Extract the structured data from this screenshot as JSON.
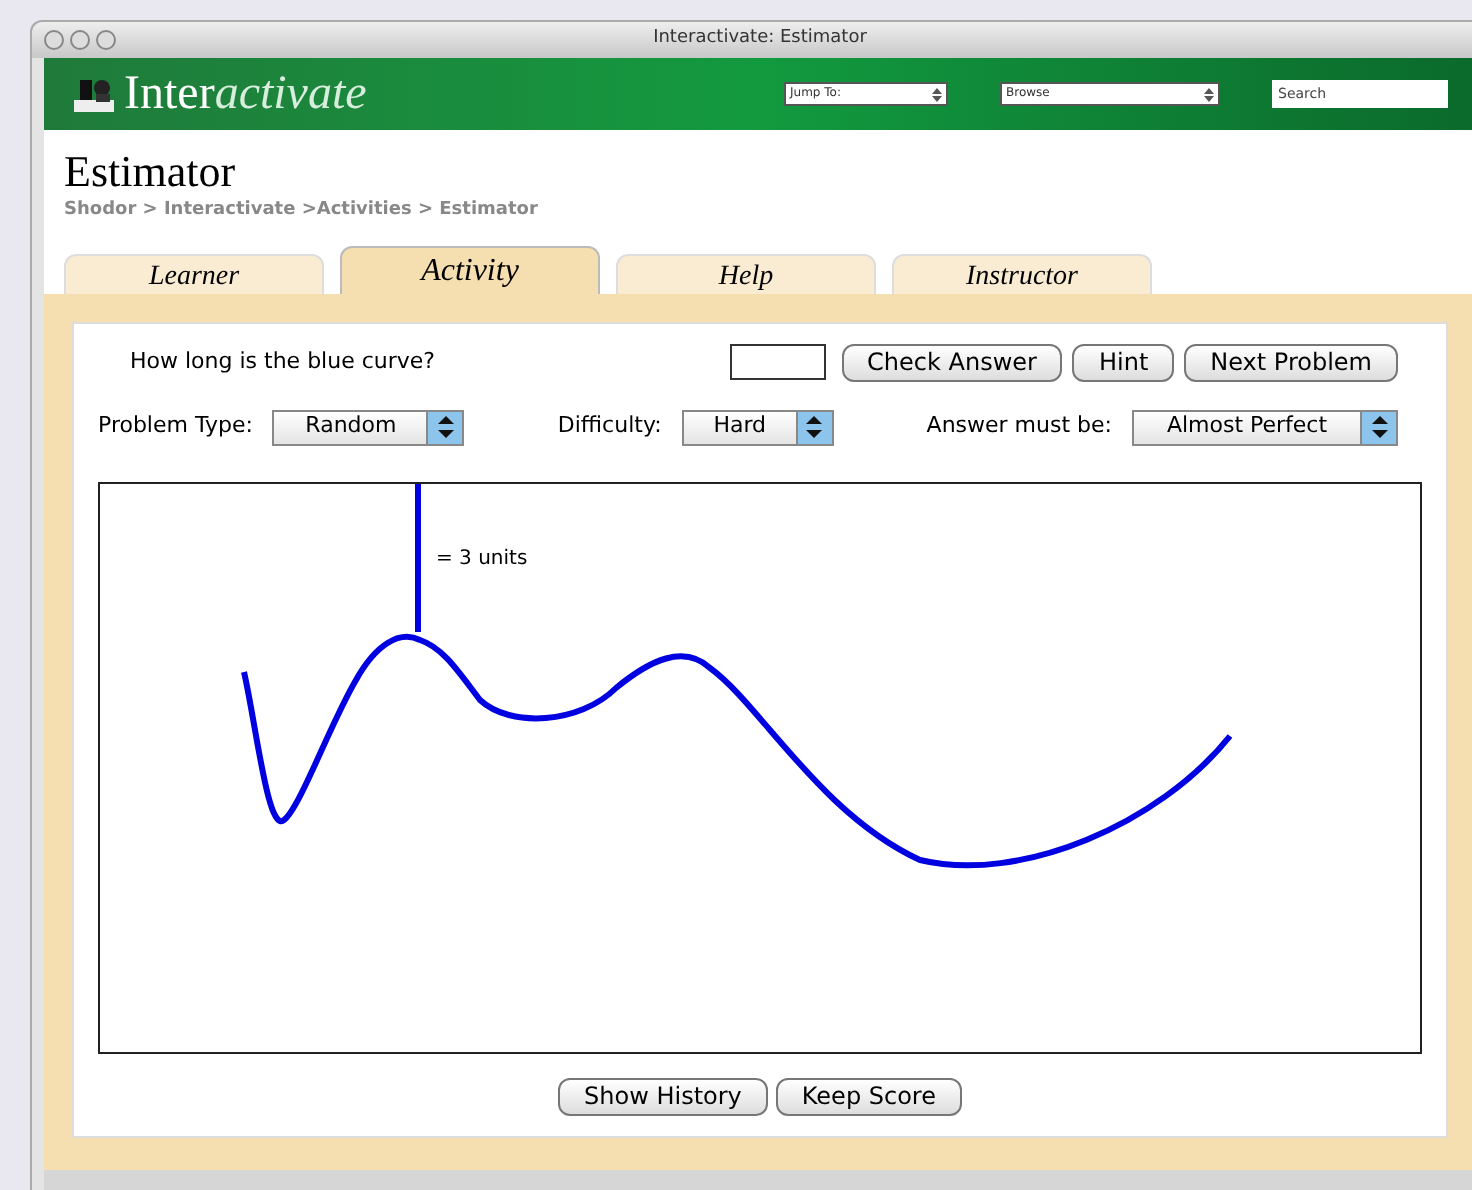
{
  "window": {
    "title": "Interactivate: Estimator"
  },
  "header": {
    "logo_plain": "Inter",
    "logo_italic": "activate",
    "fields": [
      {
        "kind": "select",
        "label": "Jump To:"
      },
      {
        "kind": "select",
        "label": "Browse"
      },
      {
        "kind": "search",
        "placeholder": "Search"
      }
    ]
  },
  "page": {
    "title": "Estimator",
    "breadcrumb": "Shodor > Interactivate >Activities > Estimator"
  },
  "tabs": [
    {
      "label": "Learner",
      "selected": false
    },
    {
      "label": "Activity",
      "selected": true
    },
    {
      "label": "Help",
      "selected": false
    },
    {
      "label": "Instructor",
      "selected": false
    }
  ],
  "question": "How long is the blue curve?",
  "buttons": [
    "Check Answer",
    "Hint",
    "Next Problem"
  ],
  "selects": [
    {
      "label": "Problem Type:",
      "value": "Random"
    },
    {
      "label": "Difficulty:",
      "value": "Hard"
    },
    {
      "label": "Answer must be:",
      "value": "Almost Perfect"
    }
  ],
  "scale_label": "= 3 units",
  "bottom_buttons": [
    "Show History",
    "Keep Score"
  ]
}
